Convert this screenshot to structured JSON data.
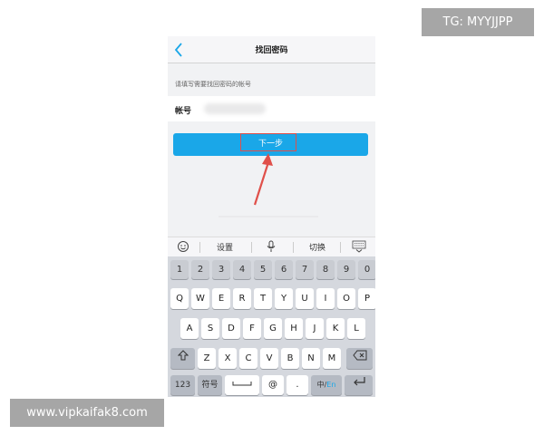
{
  "overlay": {
    "tg_text": "TG: MYYJJPP",
    "site_text": "www.vipkaifak8.com"
  },
  "nav": {
    "back_icon": "chevron-left-icon",
    "title": "找回密码"
  },
  "form": {
    "hint": "请填写需要找回密码的帐号",
    "account_label": "帐号",
    "account_value": "",
    "next_label": "下一步"
  },
  "colors": {
    "accent": "#1aa7e8",
    "highlight": "#e0504a"
  },
  "toolbar": {
    "emoji_icon": "emoji-icon",
    "settings_label": "设置",
    "mic_icon": "microphone-icon",
    "switch_label": "切换",
    "collapse_icon": "keyboard-collapse-icon"
  },
  "keyboard": {
    "numbers": [
      "1",
      "2",
      "3",
      "4",
      "5",
      "6",
      "7",
      "8",
      "9",
      "0"
    ],
    "row1": [
      "Q",
      "W",
      "E",
      "R",
      "T",
      "Y",
      "U",
      "I",
      "O",
      "P"
    ],
    "row2": [
      "A",
      "S",
      "D",
      "F",
      "G",
      "H",
      "J",
      "K",
      "L"
    ],
    "row3": [
      "Z",
      "X",
      "C",
      "V",
      "B",
      "N",
      "M"
    ],
    "shift_icon": "shift-icon",
    "delete_icon": "backspace-icon",
    "key_123": "123",
    "key_symbol": "符号",
    "space_icon": "space-icon",
    "key_at": "@",
    "key_dot": ".",
    "key_lang_zh": "中/",
    "key_lang_en": "En",
    "return_icon": "return-icon"
  }
}
